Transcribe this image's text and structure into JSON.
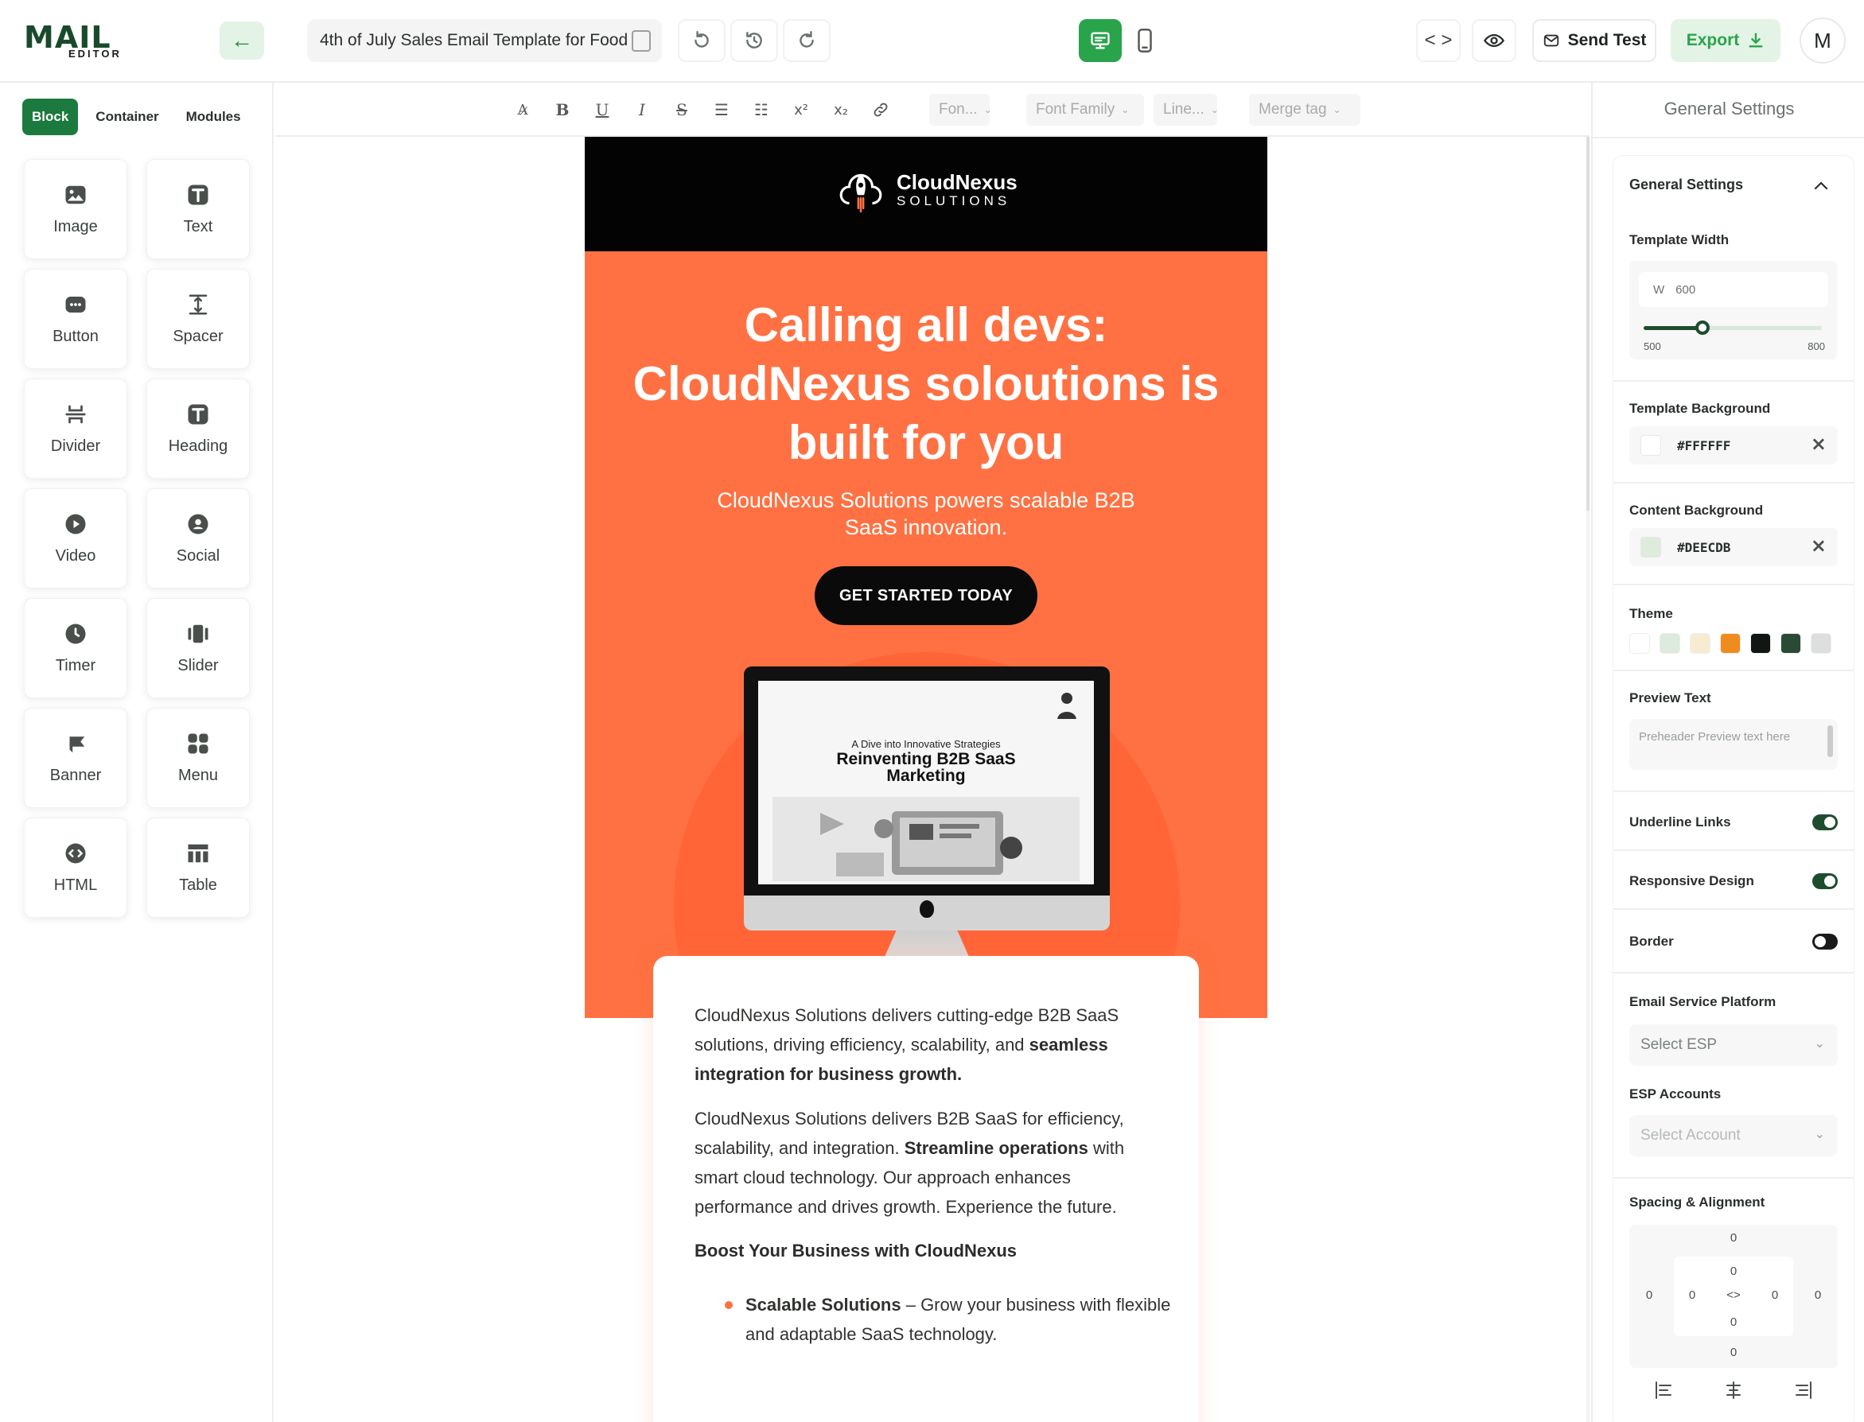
{
  "app": {
    "logo_mark": "MAIL",
    "logo_sub": "EDITOR",
    "template_title": "4th of July Sales Email Template for Food",
    "send_test_label": "Send Test",
    "export_label": "Export",
    "avatar_initial": "M",
    "accent_color": "#2aa44b"
  },
  "left": {
    "tabs": [
      {
        "label": "Block",
        "active": true
      },
      {
        "label": "Container",
        "active": false
      },
      {
        "label": "Modules",
        "active": false
      }
    ],
    "blocks": [
      {
        "label": "Image",
        "icon": "image-icon"
      },
      {
        "label": "Text",
        "icon": "text-icon"
      },
      {
        "label": "Button",
        "icon": "button-icon"
      },
      {
        "label": "Spacer",
        "icon": "spacer-icon"
      },
      {
        "label": "Divider",
        "icon": "divider-icon"
      },
      {
        "label": "Heading",
        "icon": "heading-icon"
      },
      {
        "label": "Video",
        "icon": "video-icon"
      },
      {
        "label": "Social",
        "icon": "social-icon"
      },
      {
        "label": "Timer",
        "icon": "timer-icon"
      },
      {
        "label": "Slider",
        "icon": "slider-icon"
      },
      {
        "label": "Banner",
        "icon": "banner-icon"
      },
      {
        "label": "Menu",
        "icon": "menu-icon"
      },
      {
        "label": "HTML",
        "icon": "html-icon"
      },
      {
        "label": "Table",
        "icon": "table-icon"
      }
    ]
  },
  "toolbar": {
    "buttons": [
      "text-style",
      "bold",
      "underline",
      "italic",
      "strikethrough",
      "bullet-list",
      "numbered-list",
      "superscript",
      "subscript",
      "link"
    ],
    "font_size_placeholder": "Fon...",
    "font_family_placeholder": "Font Family",
    "line_height_placeholder": "Line...",
    "merge_tag_placeholder": "Merge tag"
  },
  "email": {
    "brand_name": "CloudNexus",
    "brand_sub": "SOLUTIONS",
    "hero_title": "Calling all devs: CloudNexus soloutions is built for you",
    "hero_subtitle": "CloudNexus Solutions powers scalable B2B SaaS innovation.",
    "cta_label": "GET STARTED TODAY",
    "screen_kicker": "A Dive into Innovative Strategies",
    "screen_title": "Reinventing B2B SaaS Marketing",
    "p1_text": "CloudNexus Solutions delivers cutting-edge B2B SaaS solutions, driving efficiency, scalability, and ",
    "p1_bold": "seamless integration for business growth.",
    "p2_text_a": "CloudNexus Solutions delivers B2B SaaS for efficiency, scalability, and integration. ",
    "p2_bold": "Streamline operations",
    "p2_text_b": " with smart cloud technology. Our approach enhances performance and drives growth. Experience the future.",
    "subheading": "Boost Your Business with CloudNexus",
    "bullet_bold": "Scalable Solutions",
    "bullet_text": " – Grow your business with flexible and adaptable SaaS technology.",
    "hero_color": "#ff7142",
    "header_color": "#030303"
  },
  "settings": {
    "panel_title": "General Settings",
    "section_title": "General Settings",
    "template_width_label": "Template Width",
    "width_prefix": "W",
    "width_value": "600",
    "width_min": "500",
    "width_max": "800",
    "width_fraction": 0.33,
    "template_bg_label": "Template Background",
    "template_bg_value": "#FFFFFF",
    "content_bg_label": "Content Background",
    "content_bg_value": "#DEECDB",
    "theme_label": "Theme",
    "theme_colors": [
      "#ffffff",
      "#dcebdc",
      "#f7ecd2",
      "#f08c1e",
      "#111613",
      "#2a4a36",
      "#dddfde"
    ],
    "preview_text_label": "Preview Text",
    "preview_text_placeholder": "Preheader Preview text here",
    "underline_links_label": "Underline Links",
    "underline_links_on": true,
    "responsive_label": "Responsive Design",
    "responsive_on": true,
    "border_label": "Border",
    "border_on": false,
    "esp_label": "Email Service Platform",
    "esp_placeholder": "Select ESP",
    "esp_accounts_label": "ESP Accounts",
    "esp_accounts_placeholder": "Select Account",
    "spacing_label": "Spacing & Alignment",
    "spacing_outer": {
      "top": "0",
      "bottom": "0",
      "left": "0",
      "right": "0"
    },
    "spacing_inner": {
      "top": "0",
      "bottom": "0",
      "left": "0",
      "right": "0"
    }
  }
}
